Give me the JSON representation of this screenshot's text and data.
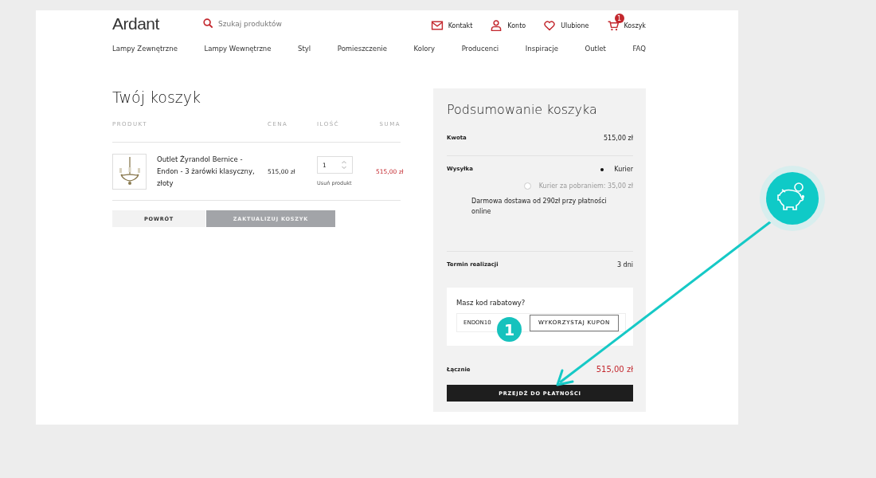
{
  "header": {
    "logo": "Ardant",
    "search": {
      "placeholder": "Szukaj produktów"
    },
    "links": [
      {
        "kind": "mail",
        "label": "Kontakt"
      },
      {
        "kind": "user",
        "label": "Konto"
      },
      {
        "kind": "heart",
        "label": "Ulubione"
      },
      {
        "kind": "cart",
        "label": "Koszyk",
        "badge": "1"
      }
    ]
  },
  "nav": [
    "Lampy Zewnętrzne",
    "Lampy Wewnętrzne",
    "Styl",
    "Pomieszczenie",
    "Kolory",
    "Producenci",
    "Inspiracje",
    "Outlet",
    "FAQ"
  ],
  "cart": {
    "title": "Twój koszyk",
    "columns": [
      "PRODUKT",
      "CENA",
      "ILOŚĆ",
      "SUMA"
    ],
    "rows": [
      {
        "name": "Outlet Żyrandol Bernice - Endon - 3 żarówki klasyczny, złoty",
        "price": "515,00 zł",
        "quantity": "1",
        "remove": "Usuń produkt",
        "total": "515,00 zł"
      }
    ],
    "buttons": [
      {
        "kind": "light",
        "label": "POWRÓT"
      },
      {
        "kind": "grey",
        "label": "ZAKTUALIZUJ KOSZYK"
      }
    ]
  },
  "summary": {
    "title": "Podsumowanie koszyka",
    "amount": {
      "label": "Kwota",
      "value": "515,00 zł"
    },
    "shipping": {
      "label": "Wysyłka",
      "options": [
        {
          "label": "Kurier",
          "selected": true
        },
        {
          "label": "Kurier za pobraniem: 35,00 zł",
          "selected": false
        }
      ],
      "note": "Darmowa dostawa od 290zł przy płatności online"
    },
    "delivery": {
      "label": "Termin realizacji",
      "value": "3 dni"
    },
    "coupon": {
      "label": "Masz kod rabatowy?",
      "value": "ENDON10",
      "button": "WYKORZYSTAJ KUPON"
    },
    "total": {
      "label": "Łącznie",
      "value": "515,00 zł"
    },
    "checkout": "PRZEJDŹ DO PŁATNOŚCI"
  },
  "overlay": {
    "step": "1"
  }
}
